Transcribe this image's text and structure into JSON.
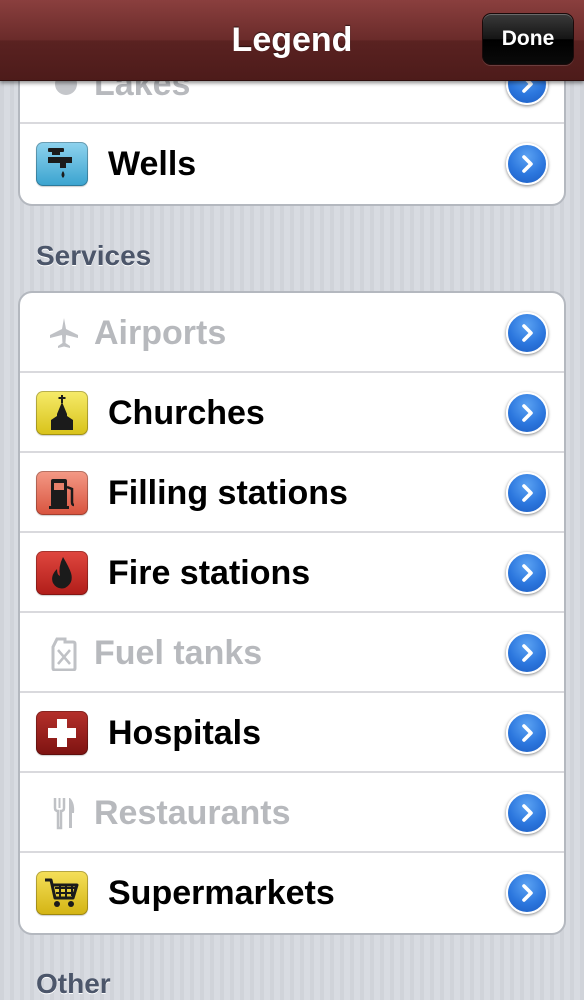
{
  "navbar": {
    "title": "Legend",
    "done_label": "Done"
  },
  "top_group": {
    "items": [
      {
        "label": "Lakes",
        "icon": "lake-dot-icon",
        "enabled": false
      },
      {
        "label": "Wells",
        "icon": "water-tap-icon",
        "enabled": true
      }
    ]
  },
  "sections": {
    "services": "Services",
    "other": "Other"
  },
  "services": {
    "items": [
      {
        "label": "Airports",
        "icon": "airplane-icon",
        "enabled": false
      },
      {
        "label": "Churches",
        "icon": "church-icon",
        "enabled": true
      },
      {
        "label": "Filling stations",
        "icon": "fuel-pump-icon",
        "enabled": true
      },
      {
        "label": "Fire stations",
        "icon": "flame-icon",
        "enabled": true
      },
      {
        "label": "Fuel tanks",
        "icon": "jerrycan-icon",
        "enabled": false
      },
      {
        "label": "Hospitals",
        "icon": "hospital-cross-icon",
        "enabled": true
      },
      {
        "label": "Restaurants",
        "icon": "fork-knife-icon",
        "enabled": false
      },
      {
        "label": "Supermarkets",
        "icon": "shopping-cart-icon",
        "enabled": true
      }
    ]
  },
  "colors": {
    "navbar": "#6a2b2a",
    "disclosure_blue": "#2c77de",
    "disabled_text": "#b7b9bd",
    "section_header": "#4c566a"
  }
}
